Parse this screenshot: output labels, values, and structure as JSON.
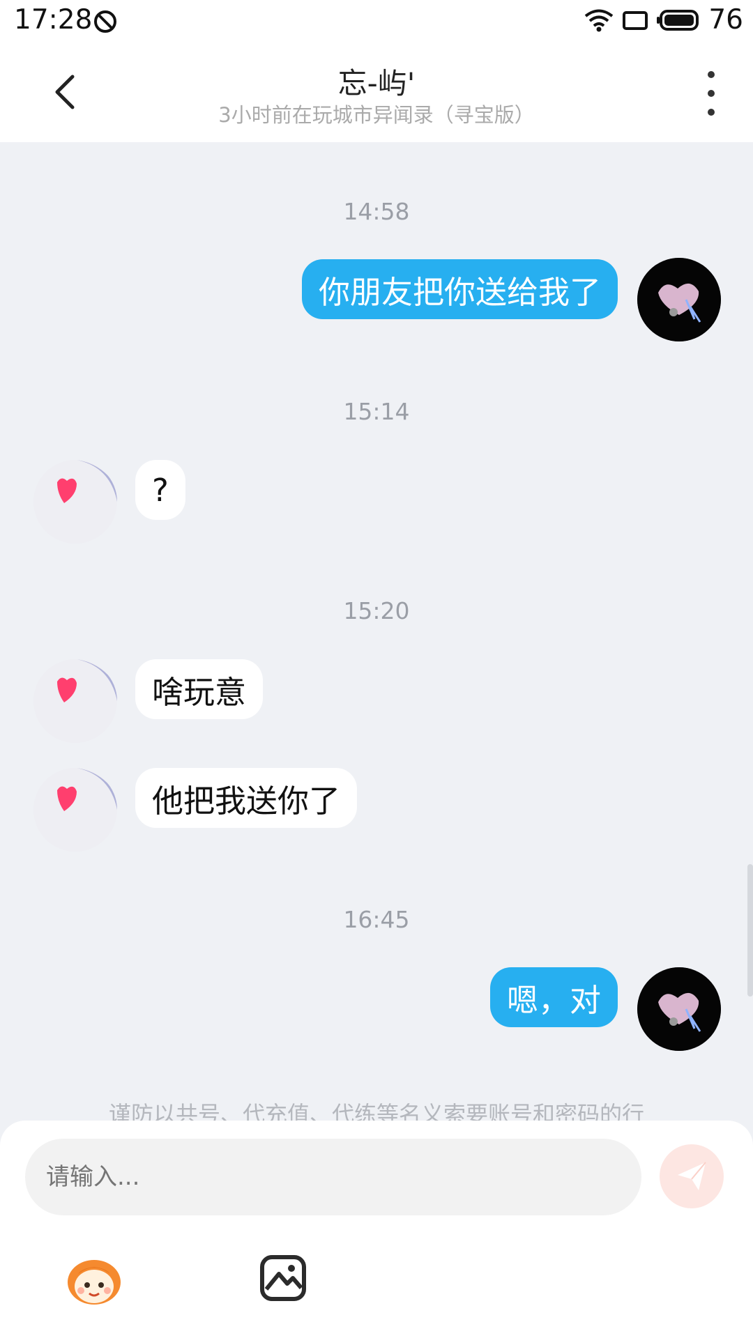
{
  "status_bar": {
    "time": "17:28",
    "battery": "76"
  },
  "header": {
    "title": "忘-屿'",
    "subtitle": "3小时前在玩城市异闻录（寻宝版）"
  },
  "messages": [
    {
      "timestamp": "14:58",
      "text": "你朋友把你送给我了",
      "from": "me"
    },
    {
      "timestamp": "15:14",
      "text": "?",
      "from": "them"
    },
    {
      "timestamp": "15:20",
      "text": "啥玩意",
      "from": "them"
    },
    {
      "text": "他把我送你了",
      "from": "them"
    },
    {
      "timestamp": "16:45",
      "text": "嗯，对",
      "from": "me"
    }
  ],
  "notice": "谨防以共号、代充值、代练等名义索要账号和密码的行",
  "composer": {
    "placeholder": "请输入..."
  },
  "colors": {
    "my_bubble": "#27aff0",
    "their_bubble": "#ffffff",
    "background": "#eff1f5",
    "send_button": "#fde6e2"
  },
  "icons": [
    "back-arrow-icon",
    "more-vertical-icon",
    "do-not-disturb-icon",
    "wifi-icon",
    "screen-rotation-icon",
    "battery-icon",
    "send-icon",
    "emoji-mascot-icon",
    "image-icon"
  ]
}
